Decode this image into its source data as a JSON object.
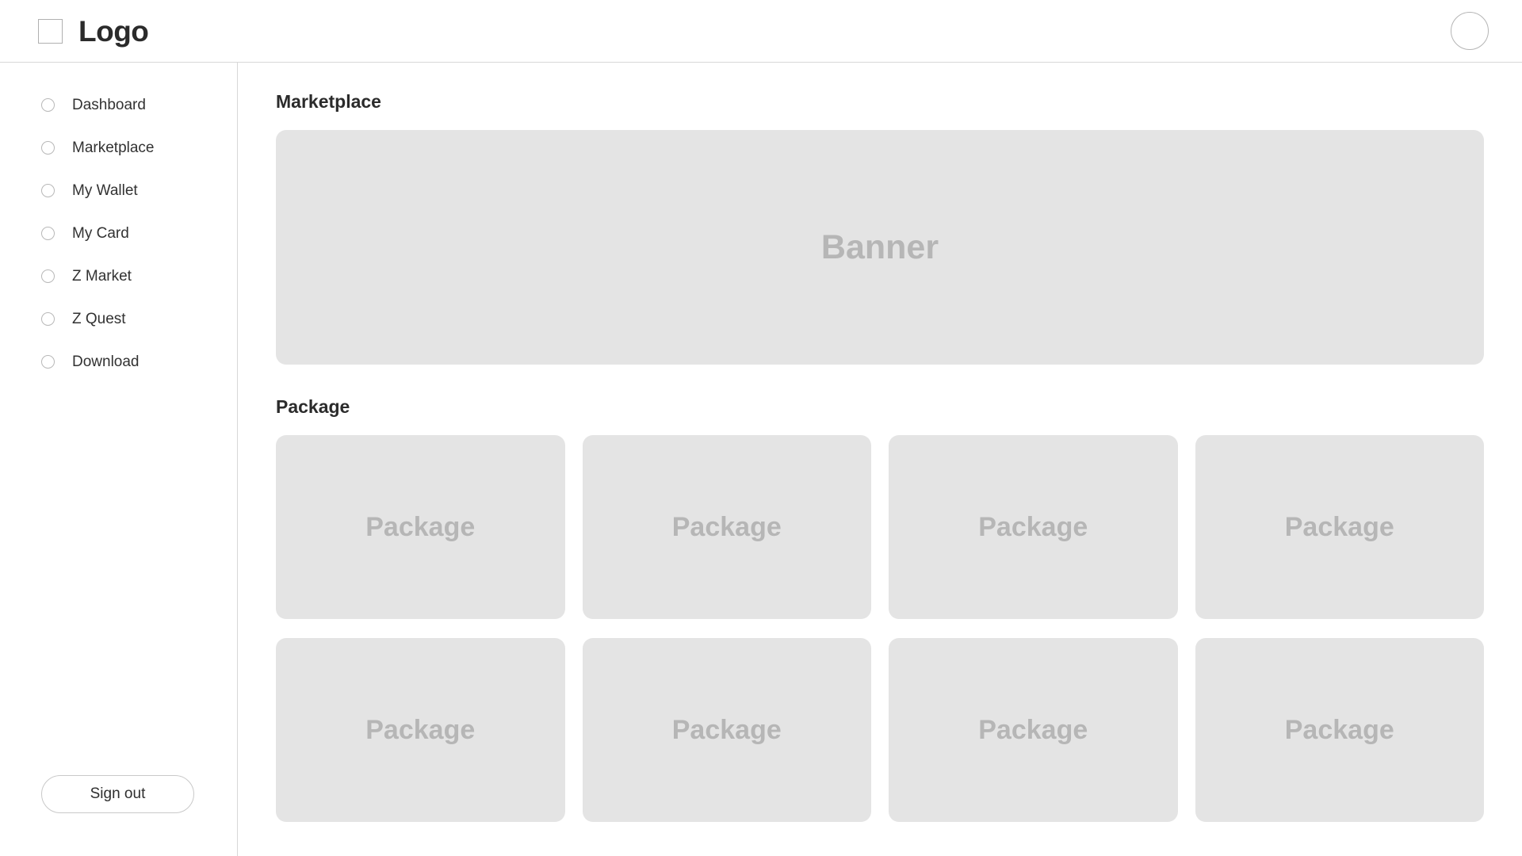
{
  "header": {
    "logo_icon": "square-logo-icon",
    "logo_text": "Logo",
    "avatar_icon": "avatar-circle-icon"
  },
  "sidebar": {
    "items": [
      {
        "label": "Dashboard",
        "icon": "circle-bullet-icon"
      },
      {
        "label": "Marketplace",
        "icon": "circle-bullet-icon"
      },
      {
        "label": "My Wallet",
        "icon": "circle-bullet-icon"
      },
      {
        "label": "My Card",
        "icon": "circle-bullet-icon"
      },
      {
        "label": "Z Market",
        "icon": "circle-bullet-icon"
      },
      {
        "label": "Z Quest",
        "icon": "circle-bullet-icon"
      },
      {
        "label": "Download",
        "icon": "circle-bullet-icon"
      }
    ],
    "signout_label": "Sign out"
  },
  "main": {
    "marketplace": {
      "title": "Marketplace",
      "banner_label": "Banner"
    },
    "package": {
      "title": "Package",
      "cards": [
        {
          "label": "Package"
        },
        {
          "label": "Package"
        },
        {
          "label": "Package"
        },
        {
          "label": "Package"
        },
        {
          "label": "Package"
        },
        {
          "label": "Package"
        },
        {
          "label": "Package"
        },
        {
          "label": "Package"
        }
      ]
    }
  },
  "colors": {
    "page_background": "#ffffff",
    "placeholder_fill": "#e4e4e4",
    "placeholder_text": "#b6b6b6",
    "border": "#d8d8d8",
    "text_primary": "#2b2b2b",
    "text_secondary": "#323232"
  }
}
